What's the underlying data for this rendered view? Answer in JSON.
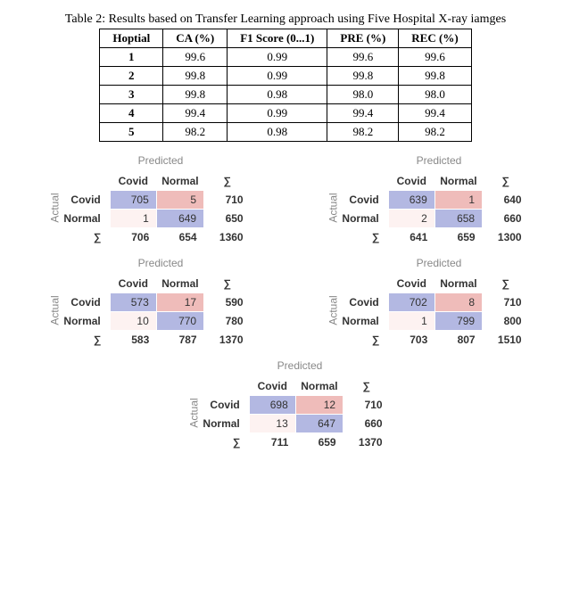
{
  "table": {
    "caption": "Table 2: Results based on Transfer Learning approach using Five Hospital X-ray iamges",
    "headers": [
      "Hoptial",
      "CA (%)",
      "F1 Score (0...1)",
      "PRE (%)",
      "REC (%)"
    ],
    "rows": [
      [
        "1",
        "99.6",
        "0.99",
        "99.6",
        "99.6"
      ],
      [
        "2",
        "99.8",
        "0.99",
        "99.8",
        "99.8"
      ],
      [
        "3",
        "99.8",
        "0.98",
        "98.0",
        "98.0"
      ],
      [
        "4",
        "99.4",
        "0.99",
        "99.4",
        "99.4"
      ],
      [
        "5",
        "98.2",
        "0.98",
        "98.2",
        "98.2"
      ]
    ]
  },
  "cm_labels": {
    "predicted": "Predicted",
    "actual": "Actual",
    "covid": "Covid",
    "normal": "Normal",
    "sigma": "∑"
  },
  "cm": [
    {
      "tp": 705,
      "fn": 5,
      "fp": 1,
      "tn": 649,
      "r1": 710,
      "r2": 650,
      "c1": 706,
      "c2": 654,
      "tot": 1360
    },
    {
      "tp": 639,
      "fn": 1,
      "fp": 2,
      "tn": 658,
      "r1": 640,
      "r2": 660,
      "c1": 641,
      "c2": 659,
      "tot": 1300
    },
    {
      "tp": 573,
      "fn": 17,
      "fp": 10,
      "tn": 770,
      "r1": 590,
      "r2": 780,
      "c1": 583,
      "c2": 787,
      "tot": 1370
    },
    {
      "tp": 702,
      "fn": 8,
      "fp": 1,
      "tn": 799,
      "r1": 710,
      "r2": 800,
      "c1": 703,
      "c2": 807,
      "tot": 1510
    },
    {
      "tp": 698,
      "fn": 12,
      "fp": 13,
      "tn": 647,
      "r1": 710,
      "r2": 660,
      "c1": 711,
      "c2": 659,
      "tot": 1370
    }
  ],
  "chart_data": [
    {
      "type": "heatmap",
      "title": "",
      "row_labels": [
        "Covid",
        "Normal"
      ],
      "col_labels": [
        "Covid",
        "Normal"
      ],
      "values": [
        [
          705,
          5
        ],
        [
          1,
          649
        ]
      ],
      "row_totals": [
        710,
        650
      ],
      "col_totals": [
        706,
        654
      ],
      "grand_total": 1360,
      "xlabel": "Predicted",
      "ylabel": "Actual"
    },
    {
      "type": "heatmap",
      "title": "",
      "row_labels": [
        "Covid",
        "Normal"
      ],
      "col_labels": [
        "Covid",
        "Normal"
      ],
      "values": [
        [
          639,
          1
        ],
        [
          2,
          658
        ]
      ],
      "row_totals": [
        640,
        660
      ],
      "col_totals": [
        641,
        659
      ],
      "grand_total": 1300,
      "xlabel": "Predicted",
      "ylabel": "Actual"
    },
    {
      "type": "heatmap",
      "title": "",
      "row_labels": [
        "Covid",
        "Normal"
      ],
      "col_labels": [
        "Covid",
        "Normal"
      ],
      "values": [
        [
          573,
          17
        ],
        [
          10,
          770
        ]
      ],
      "row_totals": [
        590,
        780
      ],
      "col_totals": [
        583,
        787
      ],
      "grand_total": 1370,
      "xlabel": "Predicted",
      "ylabel": "Actual"
    },
    {
      "type": "heatmap",
      "title": "",
      "row_labels": [
        "Covid",
        "Normal"
      ],
      "col_labels": [
        "Covid",
        "Normal"
      ],
      "values": [
        [
          702,
          8
        ],
        [
          1,
          799
        ]
      ],
      "row_totals": [
        710,
        800
      ],
      "col_totals": [
        703,
        807
      ],
      "grand_total": 1510,
      "xlabel": "Predicted",
      "ylabel": "Actual"
    },
    {
      "type": "heatmap",
      "title": "",
      "row_labels": [
        "Covid",
        "Normal"
      ],
      "col_labels": [
        "Covid",
        "Normal"
      ],
      "values": [
        [
          698,
          12
        ],
        [
          13,
          647
        ]
      ],
      "row_totals": [
        710,
        660
      ],
      "col_totals": [
        711,
        659
      ],
      "grand_total": 1370,
      "xlabel": "Predicted",
      "ylabel": "Actual"
    }
  ]
}
